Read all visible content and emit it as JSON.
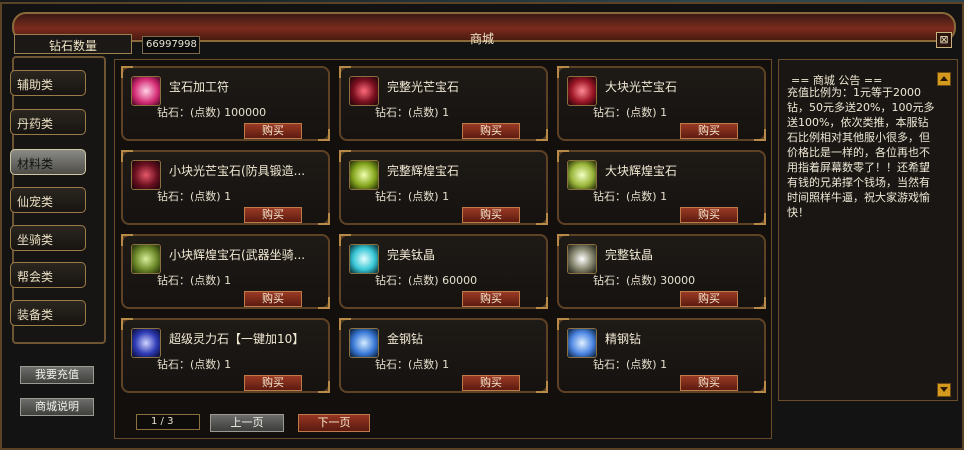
{
  "window": {
    "title": "商城",
    "close_symbol": "⊠"
  },
  "diamond": {
    "label": "钻石数量",
    "value": "66997998"
  },
  "categories": [
    {
      "label": "辅助类",
      "active": false
    },
    {
      "label": "丹药类",
      "active": false
    },
    {
      "label": "材料类",
      "active": true
    },
    {
      "label": "仙宠类",
      "active": false
    },
    {
      "label": "坐骑类",
      "active": false
    },
    {
      "label": "帮会类",
      "active": false
    },
    {
      "label": "装备类",
      "active": false
    }
  ],
  "actions": {
    "recharge": "我要充值",
    "help": "商城说明"
  },
  "items": [
    {
      "name": "宝石加工符",
      "price": "钻石：(点数) 100000",
      "buy": "购买",
      "icon": "scroll-icon",
      "color": "#d32a73"
    },
    {
      "name": "完整光芒宝石",
      "price": "钻石：(点数) 1",
      "buy": "购买",
      "icon": "red-gem-icon",
      "color": "#7b1020"
    },
    {
      "name": "大块光芒宝石",
      "price": "钻石：(点数) 1",
      "buy": "购买",
      "icon": "red-crystal-icon",
      "color": "#9d1626"
    },
    {
      "name": "小块光芒宝石(防具锻造...",
      "price": "钻石：(点数) 1",
      "buy": "购买",
      "icon": "red-gem-small-icon",
      "color": "#6b1120"
    },
    {
      "name": "完整辉煌宝石",
      "price": "钻石：(点数) 1",
      "buy": "购买",
      "icon": "green-gem-icon",
      "color": "#87a81f"
    },
    {
      "name": "大块辉煌宝石",
      "price": "钻石：(点数) 1",
      "buy": "购买",
      "icon": "green-crystal-icon",
      "color": "#9ab63a"
    },
    {
      "name": "小块辉煌宝石(武器坐骑...",
      "price": "钻石：(点数) 1",
      "buy": "购买",
      "icon": "green-gem-small-icon",
      "color": "#6e8a2a"
    },
    {
      "name": "完美钛晶",
      "price": "钻石：(点数) 60000",
      "buy": "购买",
      "icon": "cyan-orb-icon",
      "color": "#37c6d6"
    },
    {
      "name": "完整钛晶",
      "price": "钻石：(点数) 30000",
      "buy": "购买",
      "icon": "white-orb-icon",
      "color": "#8c8c75"
    },
    {
      "name": "超级灵力石【一键加10】",
      "price": "钻石：(点数) 1",
      "buy": "购买",
      "icon": "blue-rune-icon",
      "color": "#2f3bb5"
    },
    {
      "name": "金钢钻",
      "price": "钻石：(点数) 1",
      "buy": "购买",
      "icon": "blue-spark-icon",
      "color": "#3b7bd8"
    },
    {
      "name": "精钢钻",
      "price": "钻石：(点数) 1",
      "buy": "购买",
      "icon": "blue-spark-icon",
      "color": "#4c86e2"
    }
  ],
  "pager": {
    "text": "1 / 3",
    "prev": "上一页",
    "next": "下一页"
  },
  "notice": {
    "title": "== 商城 公告 ==",
    "body": "充值比例为：1元等于2000钻，50元多送20%，100元多送100%，依次类推，本服钻石比例相对其他服小很多，但价格比是一样的，各位再也不用指着屏幕数零了！！还希望有钱的兄弟撑个钱场，当然有时间照样牛逼，祝大家游戏愉快！"
  }
}
